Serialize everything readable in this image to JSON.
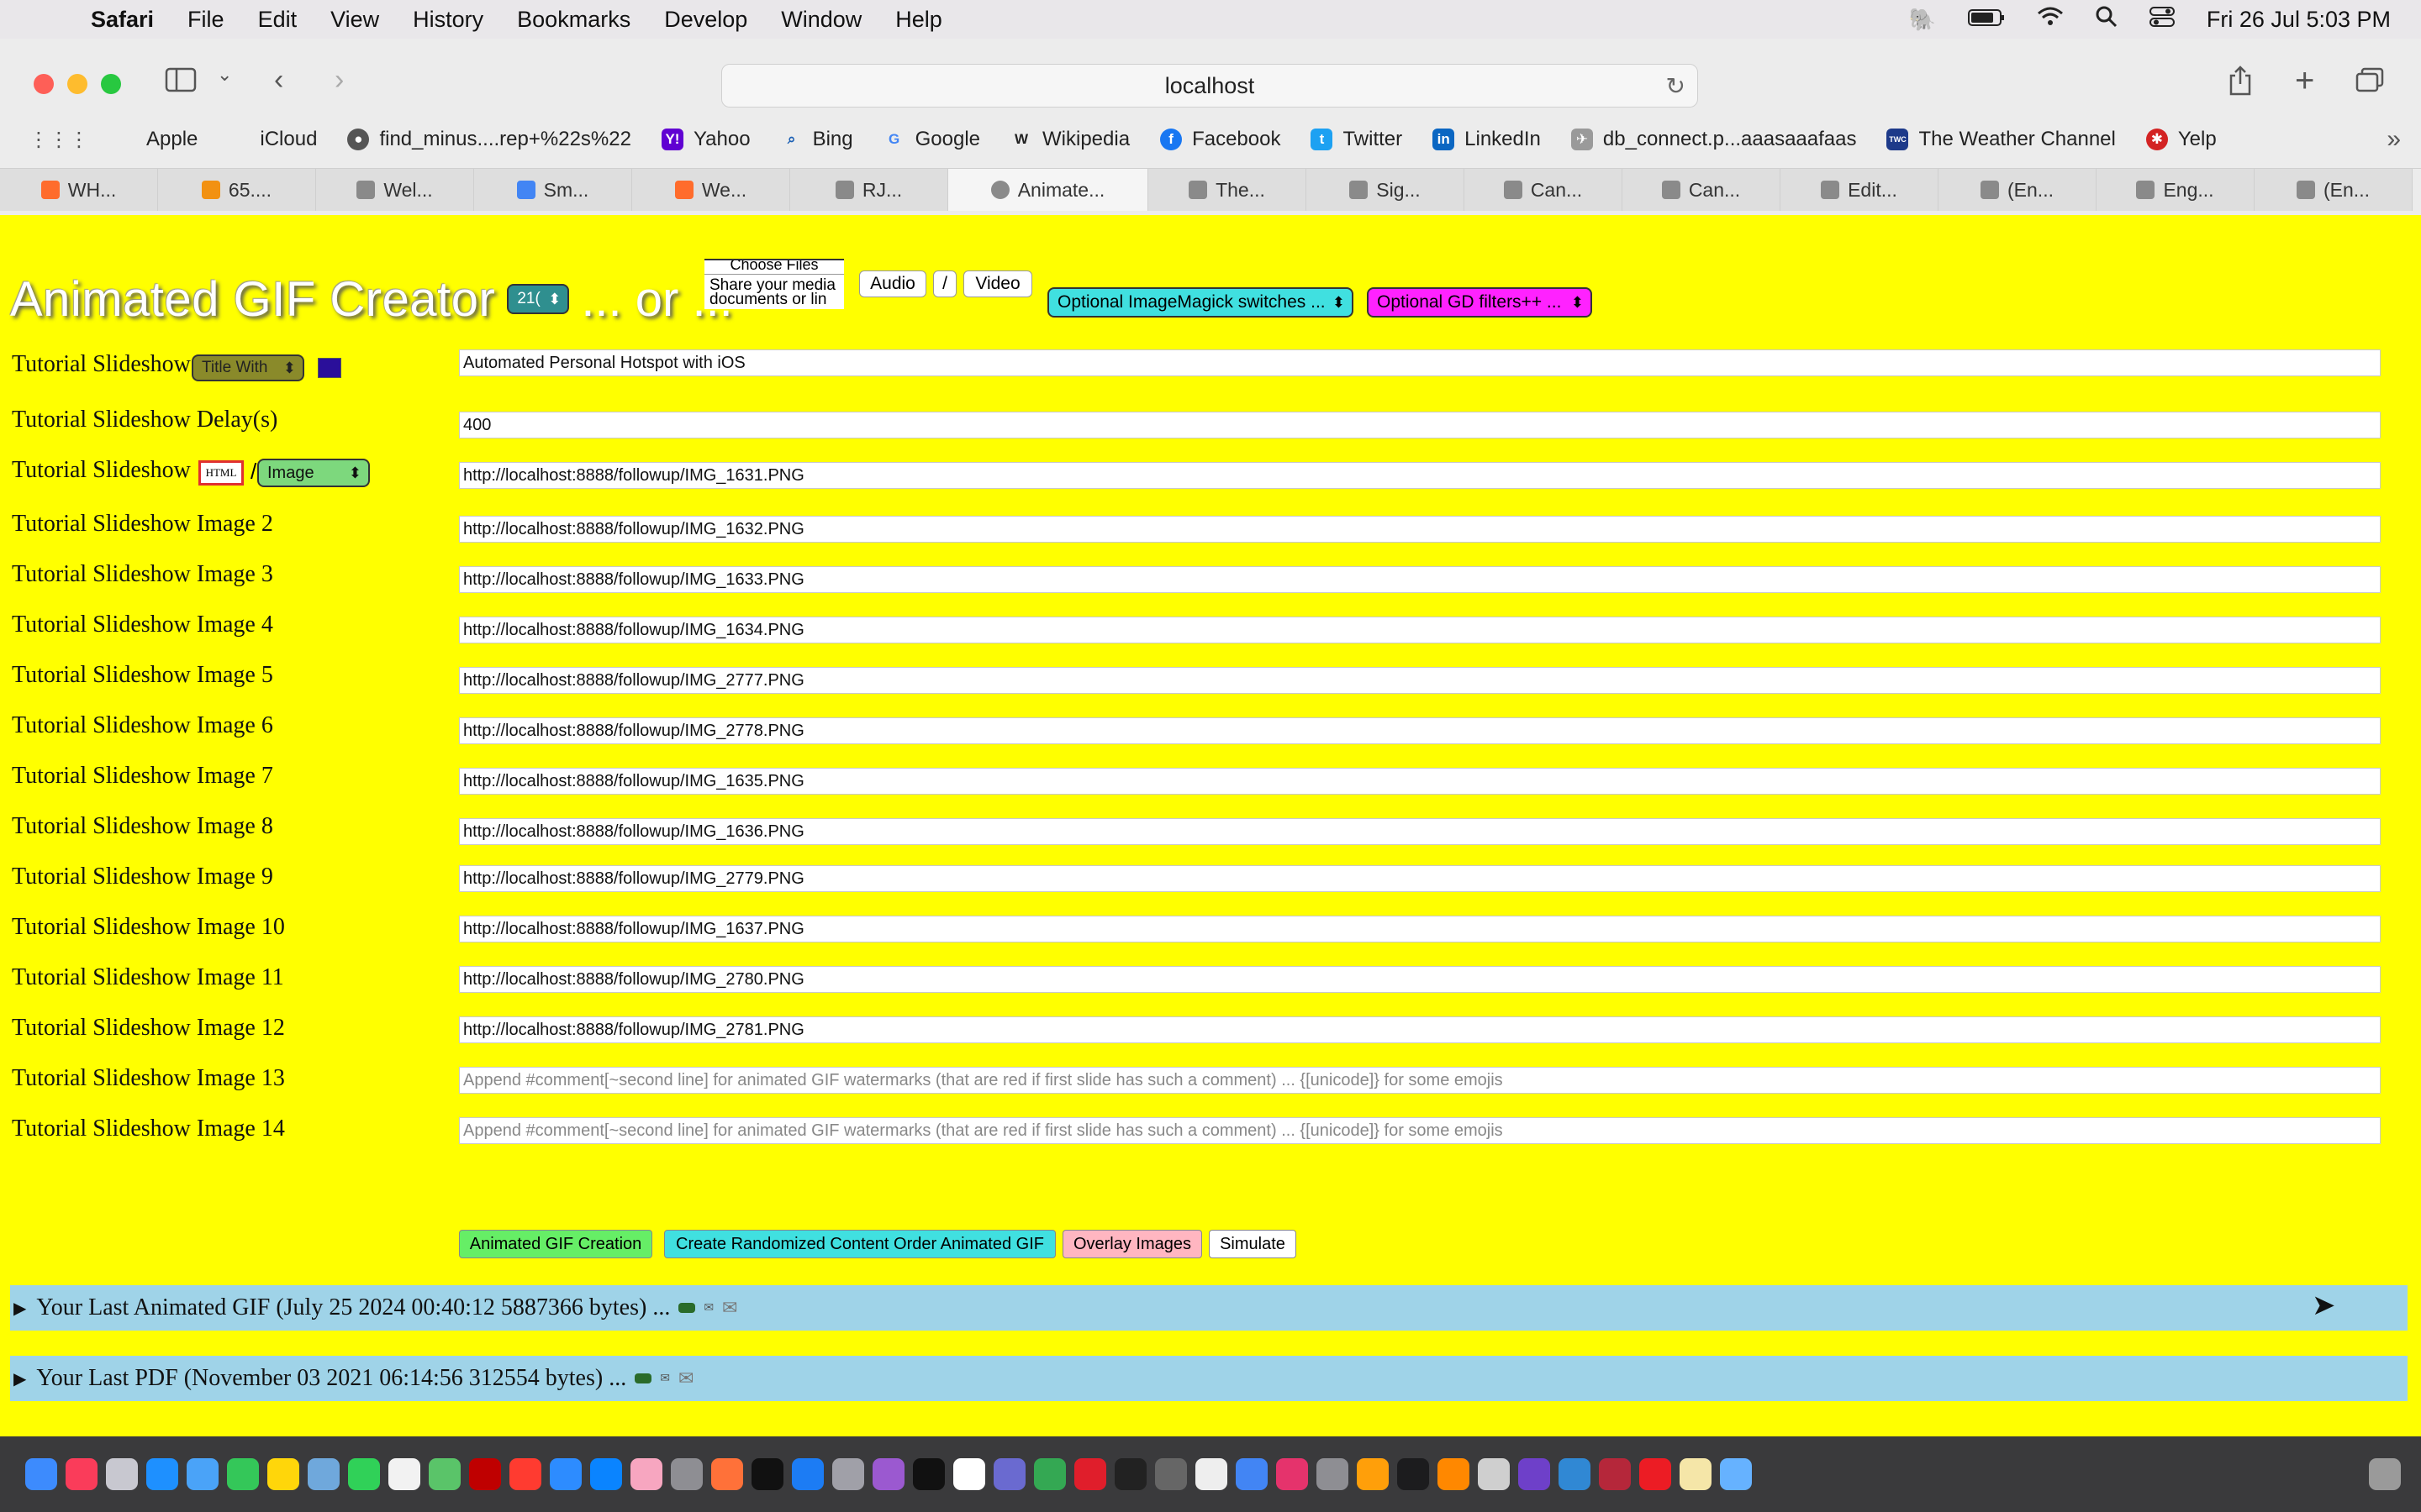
{
  "menubar": {
    "app_name": "Safari",
    "items": [
      "File",
      "Edit",
      "View",
      "History",
      "Bookmarks",
      "Develop",
      "Window",
      "Help"
    ],
    "datetime": "Fri 26 Jul  5:03 PM"
  },
  "browser": {
    "address": "localhost",
    "favorites": [
      "Apple",
      "iCloud",
      "find_minus....rep+%22s%22",
      "Yahoo",
      "Bing",
      "Google",
      "Wikipedia",
      "Facebook",
      "Twitter",
      "LinkedIn",
      "db_connect.p...aaasaaafaas",
      "The Weather Channel",
      "Yelp"
    ],
    "tabs": [
      "WH...",
      "65....",
      "Wel...",
      "Sm...",
      "We...",
      "RJ...",
      "Animate...",
      "The...",
      "Sig...",
      "Can...",
      "Can...",
      "Edit...",
      "(En...",
      "Eng...",
      "(En..."
    ]
  },
  "page": {
    "title": "Animated GIF Creator",
    "size_select": "21(",
    "or_text": "... or ...",
    "media_box_line1": "Choose Files",
    "media_box_line2": "Share your media",
    "media_box_line3": "documents or lin",
    "audio_label": "Audio",
    "slash_label": "/",
    "video_label": "Video",
    "magick_select": "Optional ImageMagick switches ...",
    "gd_select": "Optional GD filters++ ...",
    "title_with_select": "Title With",
    "html_badge": "HTML",
    "image_select": "Image",
    "rows": [
      {
        "label": "Tutorial Slideshow",
        "value": "Automated Personal Hotspot with iOS",
        "placeholder": false
      },
      {
        "label": "Tutorial Slideshow Delay(s)",
        "value": "400",
        "placeholder": false
      },
      {
        "label": "Tutorial Slideshow",
        "value": "http://localhost:8888/followup/IMG_1631.PNG",
        "placeholder": false
      },
      {
        "label": "Tutorial Slideshow Image 2",
        "value": "http://localhost:8888/followup/IMG_1632.PNG",
        "placeholder": false
      },
      {
        "label": "Tutorial Slideshow Image 3",
        "value": "http://localhost:8888/followup/IMG_1633.PNG",
        "placeholder": false
      },
      {
        "label": "Tutorial Slideshow Image 4",
        "value": "http://localhost:8888/followup/IMG_1634.PNG",
        "placeholder": false
      },
      {
        "label": "Tutorial Slideshow Image 5",
        "value": "http://localhost:8888/followup/IMG_2777.PNG",
        "placeholder": false
      },
      {
        "label": "Tutorial Slideshow Image 6",
        "value": "http://localhost:8888/followup/IMG_2778.PNG",
        "placeholder": false
      },
      {
        "label": "Tutorial Slideshow Image 7",
        "value": "http://localhost:8888/followup/IMG_1635.PNG",
        "placeholder": false
      },
      {
        "label": "Tutorial Slideshow Image 8",
        "value": "http://localhost:8888/followup/IMG_1636.PNG",
        "placeholder": false
      },
      {
        "label": "Tutorial Slideshow Image 9",
        "value": "http://localhost:8888/followup/IMG_2779.PNG",
        "placeholder": false
      },
      {
        "label": "Tutorial Slideshow Image 10",
        "value": "http://localhost:8888/followup/IMG_1637.PNG",
        "placeholder": false
      },
      {
        "label": "Tutorial Slideshow Image 11",
        "value": "http://localhost:8888/followup/IMG_2780.PNG",
        "placeholder": false
      },
      {
        "label": "Tutorial Slideshow Image 12",
        "value": "http://localhost:8888/followup/IMG_2781.PNG",
        "placeholder": false
      },
      {
        "label": "Tutorial Slideshow Image 13",
        "value": "Append #comment[~second line] for animated GIF watermarks (that are red if first slide has such a comment) ... {[unicode]} for some emojis",
        "placeholder": true
      },
      {
        "label": "Tutorial Slideshow Image 14",
        "value": "Append #comment[~second line] for animated GIF watermarks (that are red if first slide has such a comment) ... {[unicode]} for some emojis",
        "placeholder": true
      }
    ],
    "buttons": {
      "create": "Animated GIF Creation",
      "randomized": "Create Randomized Content Order Animated GIF",
      "overlay": "Overlay Images",
      "simulate": "Simulate"
    },
    "details": {
      "last_gif": "Your Last Animated GIF (July 25 2024 00:40:12 5887366 bytes) ...",
      "last_pdf": "Your Last PDF (November 03 2021 06:14:56 312554 bytes) ..."
    }
  },
  "colors": {
    "page_bg": "#ffff00",
    "create_btn": "#66ee66",
    "randomized_btn": "#40e0e0",
    "overlay_btn": "#ffb6c1",
    "details_bg": "#9fd3e8"
  }
}
